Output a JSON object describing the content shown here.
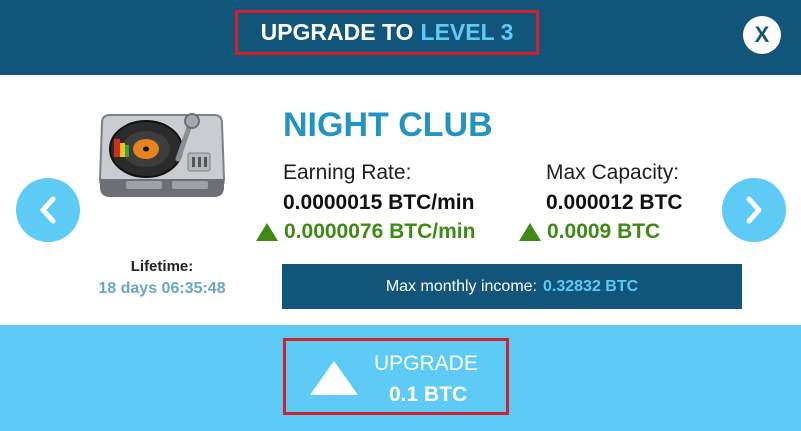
{
  "header": {
    "title_prefix": "UPGRADE TO",
    "title_level": "LEVEL 3",
    "close_label": "X"
  },
  "building": {
    "name": "NIGHT CLUB",
    "icon": "dj-turntable-icon",
    "lifetime_label": "Lifetime:",
    "lifetime_value": "18 days 06:35:48"
  },
  "stats": {
    "earning_rate_label": "Earning Rate:",
    "earning_rate_value": "0.0000015 BTC/min",
    "earning_rate_increase": "0.0000076 BTC/min",
    "max_capacity_label": "Max Capacity:",
    "max_capacity_value": "0.000012 BTC",
    "max_capacity_increase": "0.0009 BTC"
  },
  "income": {
    "label": "Max monthly income:",
    "value": "0.32832 BTC"
  },
  "upgrade": {
    "label": "UPGRADE",
    "price": "0.1 BTC"
  },
  "nav": {
    "prev_icon": "chevron-left-icon",
    "next_icon": "chevron-right-icon"
  },
  "colors": {
    "header_bg": "#11567a",
    "accent": "#5dcbf5",
    "title_blue": "#2393bf",
    "increase_green": "#3e8a14",
    "highlight_red": "#d1212f"
  }
}
